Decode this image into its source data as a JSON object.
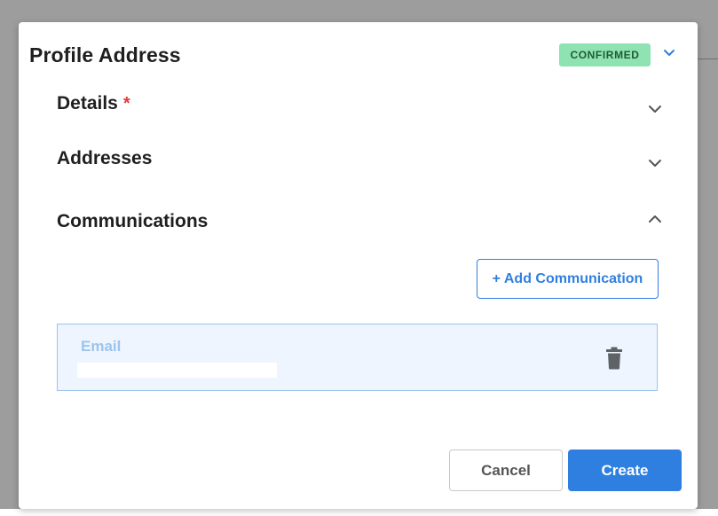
{
  "modal": {
    "title": "Profile Address",
    "status_badge": "CONFIRMED"
  },
  "sections": [
    {
      "title": "Details",
      "required_marker": "*",
      "expanded": false
    },
    {
      "title": "Addresses",
      "expanded": false
    },
    {
      "title": "Communications",
      "expanded": true
    }
  ],
  "communications": {
    "add_button_label": "+ Add Communication",
    "items": [
      {
        "type_label": "Email",
        "value": ""
      }
    ]
  },
  "footer": {
    "cancel_label": "Cancel",
    "create_label": "Create"
  },
  "colors": {
    "accent": "#2f7fe0",
    "badge_bg": "#8fe3b3",
    "badge_text": "#1f5b37",
    "required": "#e53935",
    "card_bg": "#eef5fe"
  },
  "icons": {
    "badge_toggle": "chevron-down-icon",
    "section_collapsed": "chevron-down-icon",
    "section_expanded": "chevron-up-icon",
    "delete": "trash-icon"
  }
}
